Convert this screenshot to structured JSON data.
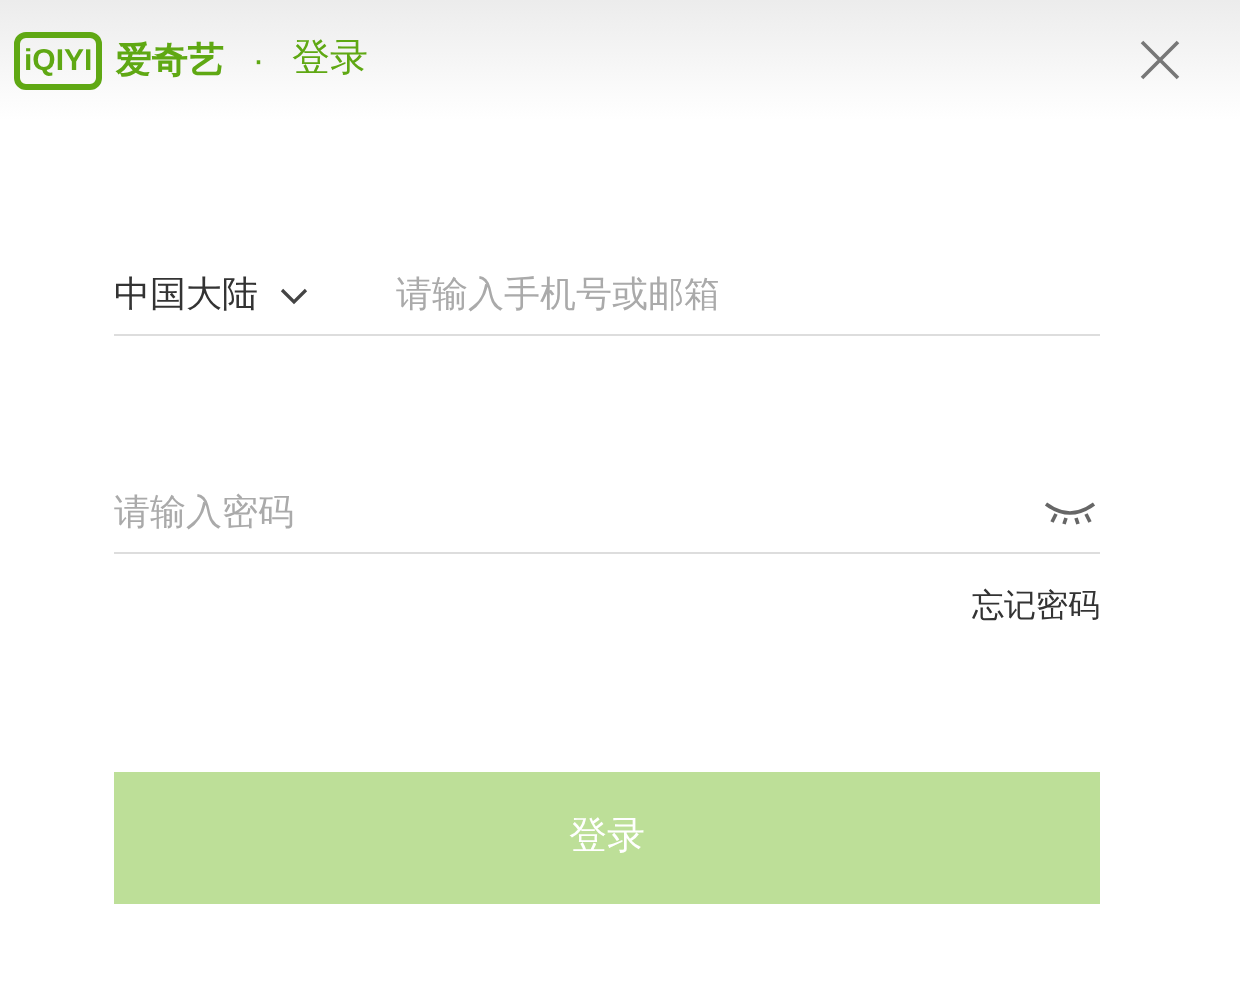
{
  "header": {
    "logo": "iQIYI",
    "brand": "爱奇艺",
    "separator": "·",
    "title": "登录"
  },
  "phone": {
    "region": "中国大陆",
    "placeholder": "请输入手机号或邮箱"
  },
  "password": {
    "placeholder": "请输入密码"
  },
  "forgot_link": "忘记密码",
  "login_button": {
    "label": "登录",
    "disabled": true
  }
}
